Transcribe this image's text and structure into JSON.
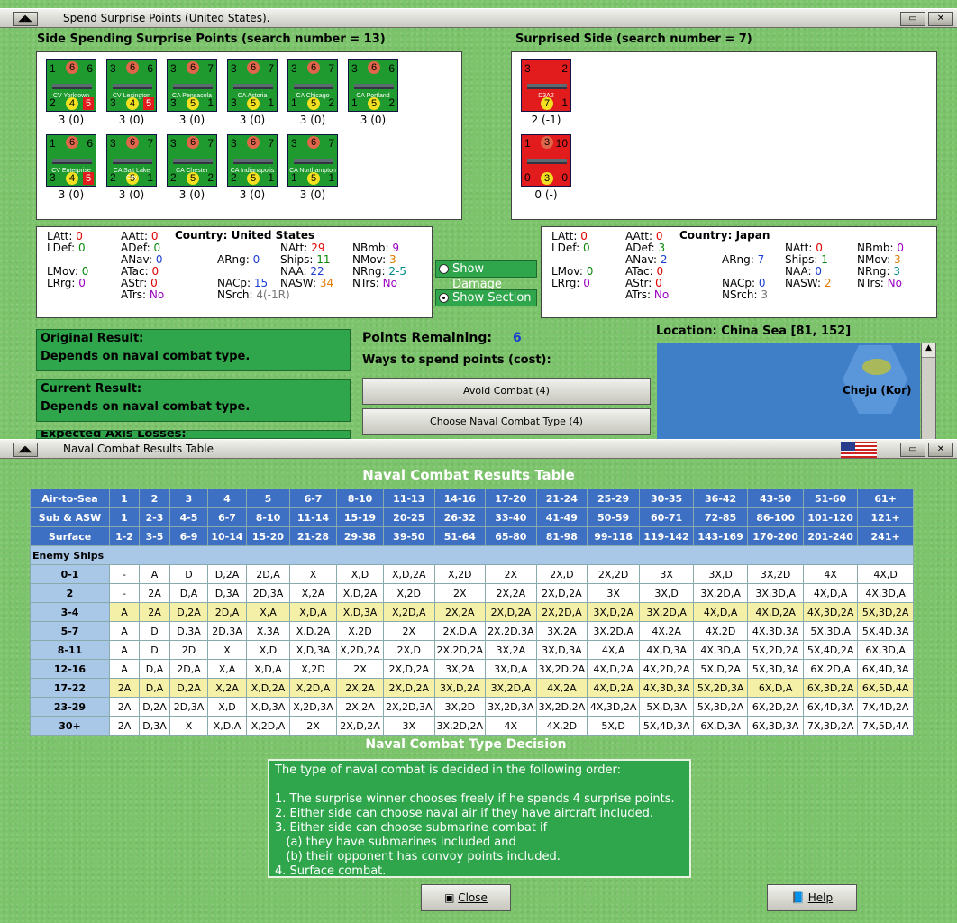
{
  "window1": {
    "title": "Spend Surprise Points (United States)."
  },
  "left_side": {
    "heading": "Side Spending Surprise Points (search number = 13)",
    "units": [
      {
        "name": "CV Yorktown",
        "tl": "1",
        "top": "6",
        "tr": "6",
        "bl": "2",
        "mid": "4",
        "br": "5",
        "cap": "3 (0)"
      },
      {
        "name": "CV Lexington",
        "tl": "3",
        "top": "6",
        "tr": "6",
        "bl": "3",
        "mid": "4",
        "br": "5",
        "cap": "3 (0)"
      },
      {
        "name": "CA Pensacola",
        "tl": "3",
        "top": "6",
        "tr": "7",
        "bl": "3",
        "mid": "5",
        "br": "1",
        "cap": "3 (0)"
      },
      {
        "name": "CA Astoria",
        "tl": "3",
        "top": "6",
        "tr": "7",
        "bl": "3",
        "mid": "5",
        "br": "1",
        "cap": "3 (0)"
      },
      {
        "name": "CA Chicago",
        "tl": "3",
        "top": "6",
        "tr": "7",
        "bl": "1",
        "mid": "5",
        "br": "2",
        "cap": "3 (0)"
      },
      {
        "name": "CA Portland",
        "tl": "3",
        "top": "6",
        "tr": "6",
        "bl": "1",
        "mid": "5",
        "br": "2",
        "cap": "3 (0)"
      },
      {
        "name": "CV Enterprise",
        "tl": "1",
        "top": "6",
        "tr": "6",
        "bl": "3",
        "mid": "4",
        "br": "5",
        "cap": "3 (0)"
      },
      {
        "name": "CA Salt Lake City",
        "tl": "3",
        "top": "6",
        "tr": "7",
        "bl": "2",
        "mid": "5",
        "br": "1",
        "cap": "3 (0)"
      },
      {
        "name": "CA Chester",
        "tl": "3",
        "top": "6",
        "tr": "7",
        "bl": "2",
        "mid": "5",
        "br": "2",
        "cap": "3 (0)"
      },
      {
        "name": "CA Indianapolis",
        "tl": "3",
        "top": "6",
        "tr": "7",
        "bl": "2",
        "mid": "5",
        "br": "1",
        "cap": "3 (0)"
      },
      {
        "name": "CA Northampton",
        "tl": "3",
        "top": "6",
        "tr": "7",
        "bl": "1",
        "mid": "5",
        "br": "1",
        "cap": "3 (0)"
      }
    ]
  },
  "right_side": {
    "heading": "Surprised Side (search number = 7)",
    "units": [
      {
        "name": "D3A2",
        "tl": "3",
        "tr": "2",
        "mid": "7",
        "br": "1",
        "cap": "2 (-1)"
      },
      {
        "name": "",
        "tl": "1",
        "top": "3",
        "tr": "10",
        "bl": "0",
        "mid": "3",
        "br": "0",
        "cap": "0 (-)"
      }
    ]
  },
  "stats_left": {
    "LAtt": "0",
    "LDef": "0",
    "LMov": "0",
    "LRrg": "0",
    "AAtt": "0",
    "ADef": "0",
    "ANav": "0",
    "ATac": "0",
    "AStr": "0",
    "ATrs": "No",
    "country": "Country: United States",
    "ARng": "0",
    "NACp": "15",
    "NSrch": "4(-1R)",
    "NAtt": "29",
    "Ships": "11",
    "NAA": "22",
    "NASW": "34",
    "NBmb": "9",
    "NMov": "3",
    "NRng": "2-5",
    "NTrs": "No"
  },
  "stats_right": {
    "LAtt": "0",
    "LDef": "0",
    "LMov": "0",
    "LRrg": "0",
    "AAtt": "0",
    "ADef": "3",
    "ANav": "2",
    "ATac": "0",
    "AStr": "0",
    "ATrs": "No",
    "country": "Country: Japan",
    "ARng": "7",
    "NACp": "0",
    "NSrch": "3",
    "NAtt": "0",
    "Ships": "1",
    "NAA": "0",
    "NASW": "2",
    "NBmb": "0",
    "NMov": "3",
    "NRng": "3",
    "NTrs": "No"
  },
  "options": {
    "show_damage": "Show Damage",
    "show_section": "Show Section"
  },
  "original_result": {
    "label": "Original Result:",
    "value": "Depends on naval combat type."
  },
  "current_result": {
    "label": "Current Result:",
    "value": "Depends on naval combat type."
  },
  "expected_losses": "Expected Axis Losses:",
  "points": {
    "label": "Points Remaining:",
    "value": "6",
    "ways": "Ways to spend points (cost):"
  },
  "buttons": {
    "avoid": "Avoid Combat (4)",
    "choose": "Choose Naval Combat Type (4)"
  },
  "location": {
    "label": "Location: China Sea [81, 152]",
    "place": "Cheju (Kor)"
  },
  "window2": {
    "title": "Naval Combat Results Table"
  },
  "crt": {
    "title": "Naval Combat Results Table",
    "headers": [
      [
        "Air-to-Sea",
        "1",
        "2",
        "3",
        "4",
        "5",
        "6-7",
        "8-10",
        "11-13",
        "14-16",
        "17-20",
        "21-24",
        "25-29",
        "30-35",
        "36-42",
        "43-50",
        "51-60",
        "61+"
      ],
      [
        "Sub & ASW",
        "1",
        "2-3",
        "4-5",
        "6-7",
        "8-10",
        "11-14",
        "15-19",
        "20-25",
        "26-32",
        "33-40",
        "41-49",
        "50-59",
        "60-71",
        "72-85",
        "86-100",
        "101-120",
        "121+"
      ],
      [
        "Surface",
        "1-2",
        "3-5",
        "6-9",
        "10-14",
        "15-20",
        "21-28",
        "29-38",
        "39-50",
        "51-64",
        "65-80",
        "81-98",
        "99-118",
        "119-142",
        "143-169",
        "170-200",
        "201-240",
        "241+"
      ]
    ],
    "enemy_label": "Enemy Ships",
    "rows": [
      [
        "0-1",
        "-",
        "A",
        "D",
        "D,2A",
        "2D,A",
        "X",
        "X,D",
        "X,D,2A",
        "X,2D",
        "2X",
        "2X,D",
        "2X,2D",
        "3X",
        "3X,D",
        "3X,2D",
        "4X",
        "4X,D"
      ],
      [
        "2",
        "-",
        "2A",
        "D,A",
        "D,3A",
        "2D,3A",
        "X,2A",
        "X,D,2A",
        "X,2D",
        "2X",
        "2X,2A",
        "2X,D,2A",
        "3X",
        "3X,D",
        "3X,2D,A",
        "3X,3D,A",
        "4X,D,A",
        "4X,3D,A"
      ],
      [
        "3-4",
        "A",
        "2A",
        "D,2A",
        "2D,A",
        "X,A",
        "X,D,A",
        "X,D,3A",
        "X,2D,A",
        "2X,2A",
        "2X,D,2A",
        "2X,2D,A",
        "3X,D,2A",
        "3X,2D,A",
        "4X,D,A",
        "4X,D,2A",
        "4X,3D,2A",
        "5X,3D,2A"
      ],
      [
        "5-7",
        "A",
        "D",
        "D,3A",
        "2D,3A",
        "X,3A",
        "X,D,2A",
        "X,2D",
        "2X",
        "2X,D,A",
        "2X,2D,3A",
        "3X,2A",
        "3X,2D,A",
        "4X,2A",
        "4X,2D",
        "4X,3D,3A",
        "5X,3D,A",
        "5X,4D,3A"
      ],
      [
        "8-11",
        "A",
        "D",
        "2D",
        "X",
        "X,D",
        "X,D,3A",
        "X,2D,2A",
        "2X,D",
        "2X,2D,2A",
        "3X,2A",
        "3X,D,3A",
        "4X,A",
        "4X,D,3A",
        "4X,3D,A",
        "5X,2D,2A",
        "5X,4D,2A",
        "6X,3D,A"
      ],
      [
        "12-16",
        "A",
        "D,A",
        "2D,A",
        "X,A",
        "X,D,A",
        "X,2D",
        "2X",
        "2X,D,2A",
        "3X,2A",
        "3X,D,A",
        "3X,2D,2A",
        "4X,D,2A",
        "4X,2D,2A",
        "5X,D,2A",
        "5X,3D,3A",
        "6X,2D,A",
        "6X,4D,3A"
      ],
      [
        "17-22",
        "2A",
        "D,A",
        "D,2A",
        "X,2A",
        "X,D,2A",
        "X,2D,A",
        "2X,2A",
        "2X,D,2A",
        "3X,D,2A",
        "3X,2D,A",
        "4X,2A",
        "4X,D,2A",
        "4X,3D,3A",
        "5X,2D,3A",
        "6X,D,A",
        "6X,3D,2A",
        "6X,5D,4A"
      ],
      [
        "23-29",
        "2A",
        "D,2A",
        "2D,3A",
        "X,D",
        "X,D,3A",
        "X,2D,3A",
        "2X,2A",
        "2X,2D,3A",
        "3X,2D",
        "3X,2D,3A",
        "3X,2D,2A",
        "4X,3D,2A",
        "5X,D,3A",
        "5X,3D,2A",
        "6X,2D,2A",
        "6X,4D,3A",
        "7X,4D,2A"
      ],
      [
        "30+",
        "2A",
        "D,3A",
        "X",
        "X,D,A",
        "X,2D,A",
        "2X",
        "2X,D,2A",
        "3X",
        "3X,2D,2A",
        "4X",
        "4X,2D",
        "5X,D",
        "5X,4D,3A",
        "6X,D,3A",
        "6X,3D,3A",
        "7X,3D,2A",
        "7X,5D,4A"
      ]
    ]
  },
  "decision": {
    "title": "Naval Combat Type Decision",
    "lines": [
      "The type of naval combat is decided in the following order:",
      "",
      "1. The surprise winner chooses freely if he spends 4 surprise points.",
      "2. Either side can choose naval air if they have aircraft included.",
      "3. Either side can choose submarine combat if",
      "   (a) they have submarines included and",
      "   (b) their opponent has convoy points included.",
      "4. Surface combat."
    ]
  },
  "footer": {
    "close": "Close",
    "help": "Help"
  }
}
